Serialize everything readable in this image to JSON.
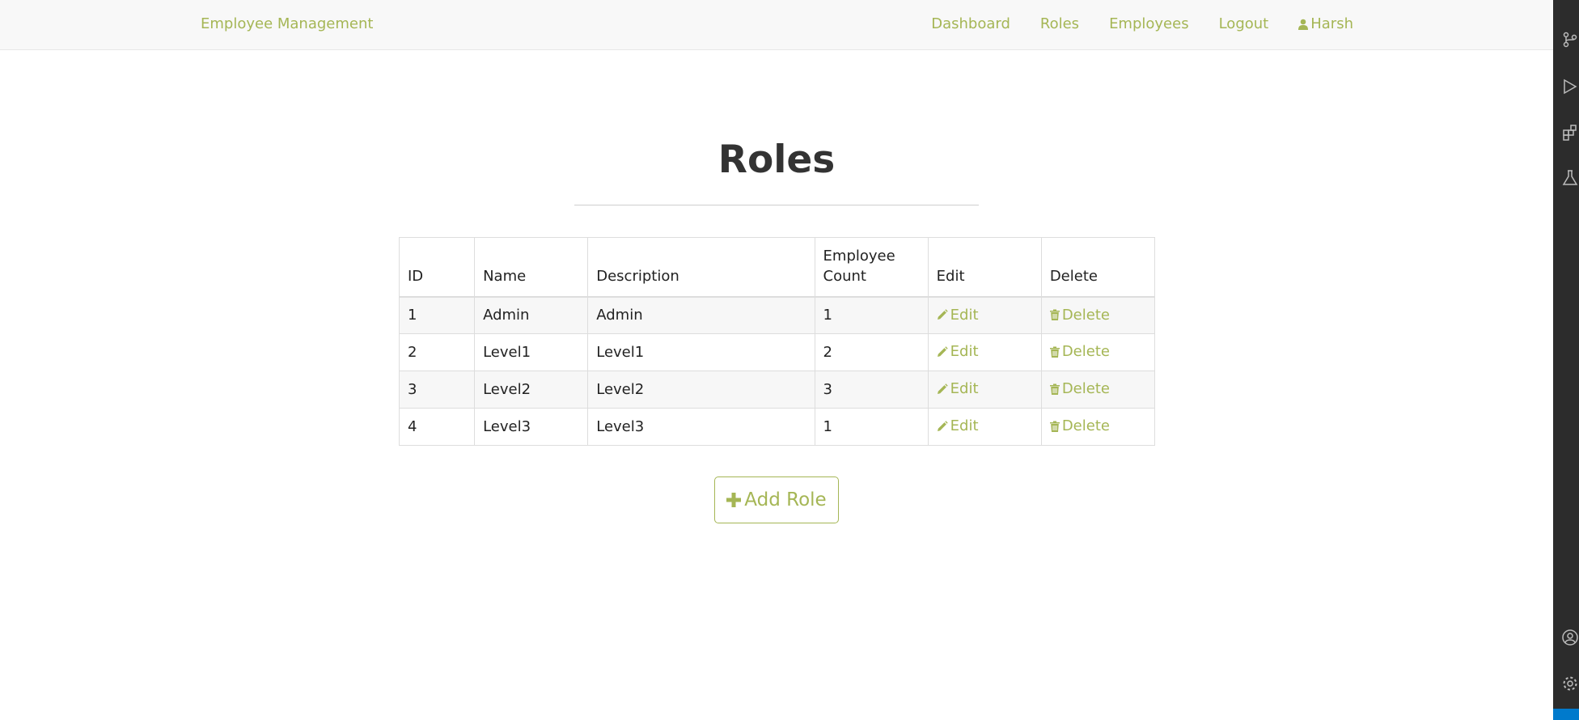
{
  "navbar": {
    "brand": "Employee Management",
    "links": {
      "dashboard": "Dashboard",
      "roles": "Roles",
      "employees": "Employees",
      "logout": "Logout",
      "user": "Harsh"
    }
  },
  "main": {
    "title": "Roles",
    "table": {
      "headers": {
        "id": "ID",
        "name": "Name",
        "description": "Description",
        "count_line1": "Employee",
        "count_line2": "Count",
        "edit": "Edit",
        "delete": "Delete"
      },
      "rows": [
        {
          "id": "1",
          "name": "Admin",
          "description": "Admin",
          "count": "1",
          "edit": "Edit",
          "delete": "Delete"
        },
        {
          "id": "2",
          "name": "Level1",
          "description": "Level1",
          "count": "2",
          "edit": "Edit",
          "delete": "Delete"
        },
        {
          "id": "3",
          "name": "Level2",
          "description": "Level2",
          "count": "3",
          "edit": "Edit",
          "delete": "Delete"
        },
        {
          "id": "4",
          "name": "Level3",
          "description": "Level3",
          "count": "1",
          "edit": "Edit",
          "delete": "Delete"
        }
      ]
    },
    "add_button": "Add Role"
  },
  "icons": {
    "user": "user-icon",
    "edit": "pencil-icon",
    "delete": "trash-icon",
    "add": "plus-icon"
  },
  "colors": {
    "accent": "#a5b655",
    "navbar_bg": "#f8f8f8",
    "activity_bar": "#2c2c2c"
  }
}
